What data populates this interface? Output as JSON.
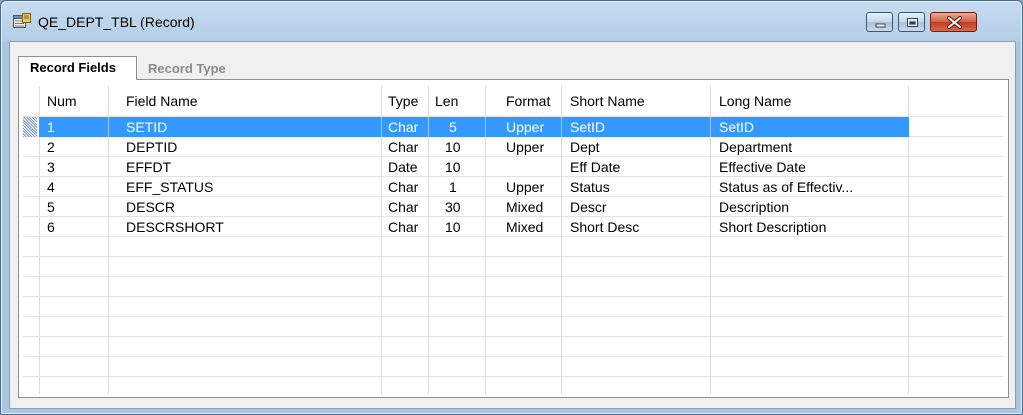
{
  "window": {
    "title": "QE_DEPT_TBL (Record)"
  },
  "tabs": [
    {
      "label": "Record Fields",
      "active": true
    },
    {
      "label": "Record Type",
      "active": false
    }
  ],
  "table": {
    "headers": [
      "Num",
      "Field Name",
      "Type",
      "Len",
      "Format",
      "Short Name",
      "Long Name"
    ],
    "rows": [
      {
        "num": "1",
        "field_name": "SETID",
        "type": "Char",
        "len": "5",
        "format": "Upper",
        "short_name": "SetID",
        "long_name": "SetID",
        "selected": true
      },
      {
        "num": "2",
        "field_name": "DEPTID",
        "type": "Char",
        "len": "10",
        "format": "Upper",
        "short_name": "Dept",
        "long_name": "Department"
      },
      {
        "num": "3",
        "field_name": "EFFDT",
        "type": "Date",
        "len": "10",
        "format": "",
        "short_name": "Eff Date",
        "long_name": "Effective Date"
      },
      {
        "num": "4",
        "field_name": "EFF_STATUS",
        "type": "Char",
        "len": "1",
        "format": "Upper",
        "short_name": "Status",
        "long_name": "Status as of Effectiv..."
      },
      {
        "num": "5",
        "field_name": "DESCR",
        "type": "Char",
        "len": "30",
        "format": "Mixed",
        "short_name": "Descr",
        "long_name": "Description"
      },
      {
        "num": "6",
        "field_name": "DESCRSHORT",
        "type": "Char",
        "len": "10",
        "format": "Mixed",
        "short_name": "Short Desc",
        "long_name": "Short Description"
      }
    ]
  },
  "icons": {
    "app": "record-icon",
    "minimize": "minimize-icon",
    "maximize": "maximize-icon",
    "close": "close-icon"
  },
  "colors": {
    "selection": "#3399ff",
    "close_button": "#c23c1f"
  }
}
